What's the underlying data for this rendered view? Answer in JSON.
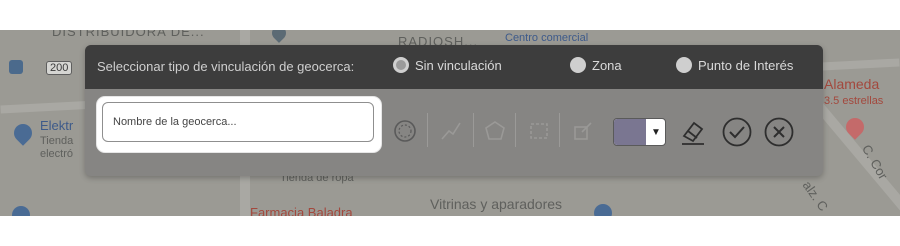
{
  "map": {
    "labels": {
      "distribuidora": "DISTRIBUIDORA DE...",
      "route_number": "200",
      "centro_comercial": "Centro comercial",
      "radioshack": "RADIOSH...",
      "elektra": "Elektr",
      "tienda": "Tienda",
      "electro": "electró",
      "alameda": "Alameda",
      "estrellas": "3.5 estrellas",
      "tienda_ropa": "Tienda de ropa",
      "farmacia": "Farmacia Baladra",
      "vitrinas": "Vitrinas y aparadores",
      "calle_c": "C. Cor",
      "calz": "alz. C"
    }
  },
  "geofence_toolbar": {
    "header_label": "Seleccionar tipo de vinculación de geocerca:",
    "options": [
      {
        "label": "Sin vinculación",
        "selected": true
      },
      {
        "label": "Zona",
        "selected": false
      },
      {
        "label": "Punto de Interés",
        "selected": false
      }
    ],
    "name_input": {
      "placeholder": "Nombre de la geocerca...",
      "value": ""
    },
    "tools": [
      "circle-tool-icon",
      "polyline-tool-icon",
      "polygon-tool-icon",
      "rectangle-tool-icon",
      "edit-tool-icon"
    ],
    "color": {
      "value": "#7a7691"
    },
    "actions": [
      "eraser-icon",
      "confirm-icon",
      "cancel-icon"
    ]
  }
}
